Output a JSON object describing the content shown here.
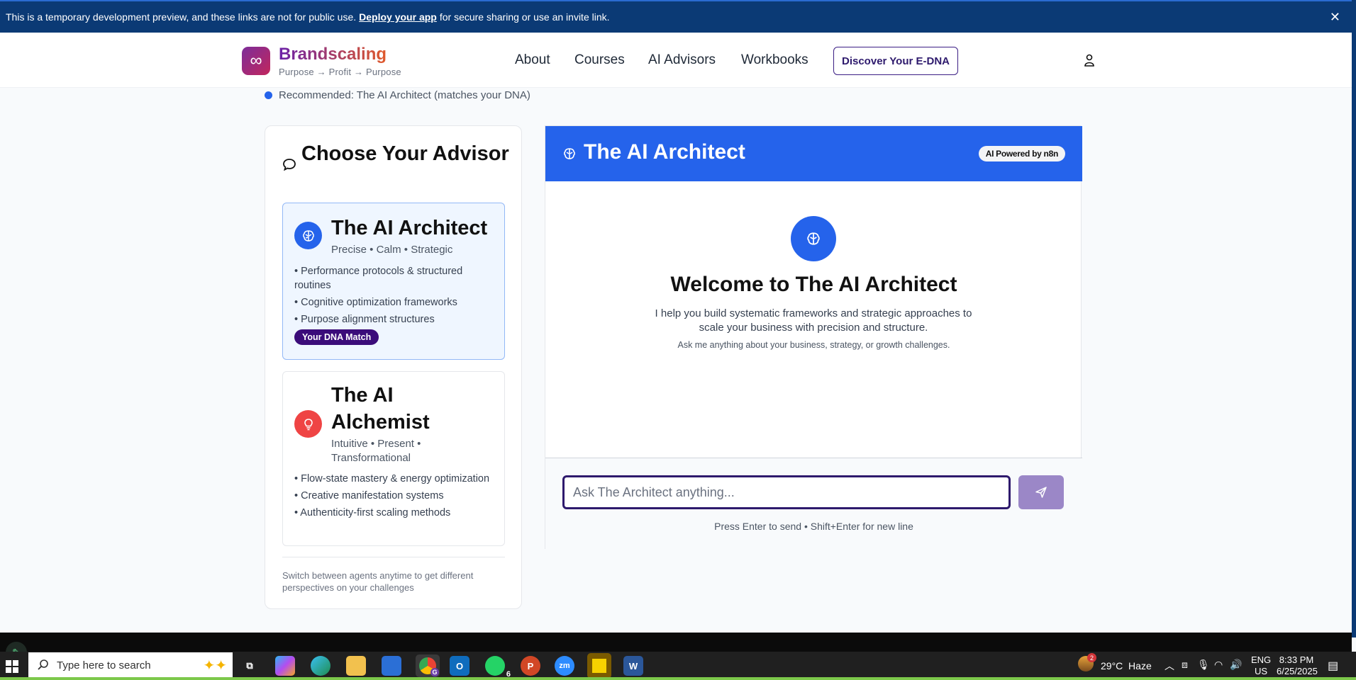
{
  "banner": {
    "text_before": "This is a temporary development preview, and these links are not for public use.",
    "link": "Deploy your app",
    "text_after": "for secure sharing or use an invite link.",
    "close": "✕"
  },
  "header": {
    "logo_symbol": "∞",
    "brand": "Brandscaling",
    "tagline": "Purpose → Profit → Purpose",
    "nav": [
      "About",
      "Courses",
      "AI Advisors",
      "Workbooks"
    ],
    "cta": "Discover Your E-DNA"
  },
  "recommendation": "Recommended: The AI Architect (matches your DNA)",
  "advisor_panel": {
    "title": "Choose Your Advisor",
    "advisors": [
      {
        "name": "The AI Architect",
        "traits": "Precise • Calm • Strategic",
        "bullets": [
          "• Performance protocols & structured routines",
          "• Cognitive optimization frameworks",
          "• Purpose alignment structures"
        ],
        "badge": "Your DNA Match",
        "icon": "brain-icon",
        "color": "#2563eb"
      },
      {
        "name": "The AI Alchemist",
        "traits": "Intuitive • Present • Transformational",
        "bullets": [
          "• Flow-state mastery & energy optimization",
          "• Creative manifestation systems",
          "• Authenticity-first scaling methods"
        ],
        "icon": "lightbulb-icon",
        "color": "#ef4444"
      }
    ],
    "footer": "Switch between agents anytime to get different perspectives on your challenges"
  },
  "chat": {
    "title": "The AI Architect",
    "pill": "AI Powered by n8n",
    "welcome_title": "Welcome to The AI Architect",
    "welcome_text": "I help you build systematic frameworks and strategic approaches to scale your business with precision and structure.",
    "welcome_sub": "Ask me anything about your business, strategy, or growth challenges.",
    "input_placeholder": "Ask The Architect anything...",
    "hint": "Press Enter to send • Shift+Enter for new line"
  },
  "taskbar": {
    "search_placeholder": "Type here to search",
    "weather": "29°C  Haze",
    "weather_badge": "2",
    "lang": "ENG",
    "region": "US",
    "time": "8:33 PM",
    "date": "6/25/2025",
    "chrome_badge": "G",
    "whatsapp_badge": "6",
    "apps": [
      "task-view",
      "copilot",
      "edge",
      "file-explorer",
      "store",
      "chrome",
      "outlook",
      "whatsapp",
      "powerpoint",
      "zoom",
      "sticky-notes",
      "word"
    ]
  }
}
